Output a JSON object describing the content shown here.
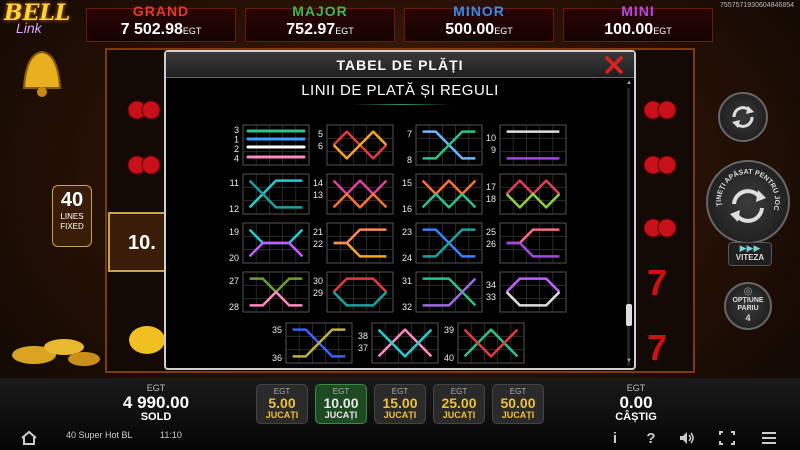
{
  "serial": "7557571930604846854",
  "logo": {
    "line1": "BELL",
    "line2": "Link"
  },
  "jackpots": [
    {
      "name": "GRAND",
      "value": "7 502.98",
      "currency": "EGT",
      "color": "#e23a2a"
    },
    {
      "name": "MAJOR",
      "value": "752.97",
      "currency": "EGT",
      "color": "#3fb84a"
    },
    {
      "name": "MINOR",
      "value": "500.00",
      "currency": "EGT",
      "color": "#3a8ae8"
    },
    {
      "name": "MINI",
      "value": "100.00",
      "currency": "EGT",
      "color": "#b44ae0"
    }
  ],
  "lines_box": {
    "count": "40",
    "label1": "LINES",
    "label2": "FIXED"
  },
  "partial_value": "10.",
  "modal": {
    "title": "TABEL DE PLĂȚI",
    "subtitle": "LINII DE PLATĂ ȘI REGULI"
  },
  "paylines": [
    {
      "labels": [
        "3",
        "1",
        "2",
        "4"
      ]
    },
    {
      "labels": [
        "5",
        "6"
      ]
    },
    {
      "labels": [
        "7",
        "8"
      ]
    },
    {
      "labels": [
        "10",
        "9"
      ]
    },
    {
      "labels": [
        "11",
        "12"
      ]
    },
    {
      "labels": [
        "14",
        "13"
      ]
    },
    {
      "labels": [
        "15",
        "16"
      ]
    },
    {
      "labels": [
        "17",
        "18"
      ]
    },
    {
      "labels": [
        "19",
        "20"
      ]
    },
    {
      "labels": [
        "21",
        "22"
      ]
    },
    {
      "labels": [
        "23",
        "24"
      ]
    },
    {
      "labels": [
        "25",
        "26"
      ]
    },
    {
      "labels": [
        "27",
        "28"
      ]
    },
    {
      "labels": [
        "30",
        "29"
      ]
    },
    {
      "labels": [
        "31",
        "32"
      ]
    },
    {
      "labels": [
        "34",
        "33"
      ]
    },
    {
      "labels": [
        "35",
        "36"
      ]
    },
    {
      "labels": [
        "38",
        "37"
      ]
    },
    {
      "labels": [
        "39",
        "40"
      ]
    }
  ],
  "controls": {
    "autoplay_text": "ȚINEȚI APĂSAT PENTRU JOC RAPID",
    "speed_label": "VITEZA",
    "options_label1": "OPȚIUNE",
    "options_label2": "PARIU",
    "options_value": "4"
  },
  "balance": {
    "currency": "EGT",
    "value": "4 990.00",
    "label": "SOLD"
  },
  "win": {
    "currency": "EGT",
    "value": "0.00",
    "label": "CÂȘTIG"
  },
  "bets": [
    {
      "currency": "EGT",
      "value": "5.00",
      "label": "JUCAȚI",
      "selected": false
    },
    {
      "currency": "EGT",
      "value": "10.00",
      "label": "JUCAȚI",
      "selected": true
    },
    {
      "currency": "EGT",
      "value": "15.00",
      "label": "JUCAȚI",
      "selected": false
    },
    {
      "currency": "EGT",
      "value": "25.00",
      "label": "JUCAȚI",
      "selected": false
    },
    {
      "currency": "EGT",
      "value": "50.00",
      "label": "JUCAȚI",
      "selected": false
    }
  ],
  "footer": {
    "game_name": "40 Super Hot BL",
    "time": "11:10"
  }
}
